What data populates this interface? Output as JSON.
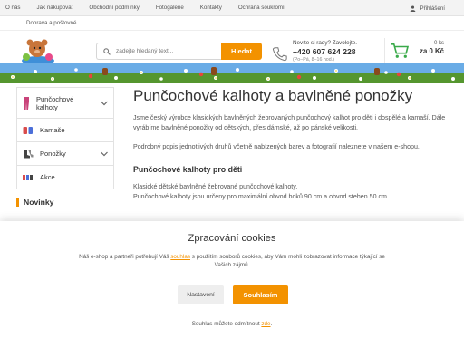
{
  "topnav": {
    "items": [
      "O nás",
      "Jak nakupovat",
      "Obchodní podmínky",
      "Fotogalerie",
      "Kontakty",
      "Ochrana soukromí"
    ],
    "second_row": "Doprava a poštovné",
    "login": "Přihlášení"
  },
  "search": {
    "placeholder": "zadejte hledaný text...",
    "button": "Hledat"
  },
  "contact": {
    "question": "Nevíte si rady? Zavolejte.",
    "phone": "+420 607 624 228",
    "hours": "(Po–Pá, 8–16 hod.)"
  },
  "cart": {
    "count": "0 ks",
    "total": "za 0 Kč"
  },
  "sidebar": {
    "items": [
      {
        "label": "Punčochové kalhoty",
        "icon": "tights-icon"
      },
      {
        "label": "Kamaše",
        "icon": "legwarmers-icon"
      },
      {
        "label": "Ponožky",
        "icon": "socks-icon"
      },
      {
        "label": "Akce",
        "icon": "sale-icon"
      }
    ],
    "news_title": "Novinky"
  },
  "main": {
    "title": "Punčochové kalhoty a bavlněné ponožky",
    "intro": "Jsme český výrobce klasických bavlněných žebrovaných punčochový kalhot pro děti i dospělé a kamaší. Dále vyrábíme bavlněné ponožky od dětských, přes dámské, až po pánské velikosti.",
    "intro2": "Podrobný popis jednotlivých druhů včetně nabízených barev a fotografií naleznete v našem e-shopu.",
    "section_title": "Punčochové kalhoty pro děti",
    "section_text1": "Klasické dětské bavlněné žebrované punčochové kalhoty.",
    "section_text2": "Punčochové kalhoty jsou určeny pro maximální obvod boků 90 cm a obvod stehen 50 cm."
  },
  "cookies": {
    "title": "Zpracování cookies",
    "text_before": "Náš e-shop a partneři potřebují Váš",
    "text_link": "souhlas",
    "text_after": "s použitím souborů cookies, aby Vám mohli zobrazovat informace týkající se Vašich zájmů.",
    "btn_settings": "Nastavení",
    "btn_accept": "Souhlasím",
    "footer_before": "Souhlas můžete odmítnout",
    "footer_link": "zde"
  },
  "colors": {
    "accent": "#f39200",
    "banner_sky": "#62a6e4",
    "banner_grass": "#55962f"
  }
}
